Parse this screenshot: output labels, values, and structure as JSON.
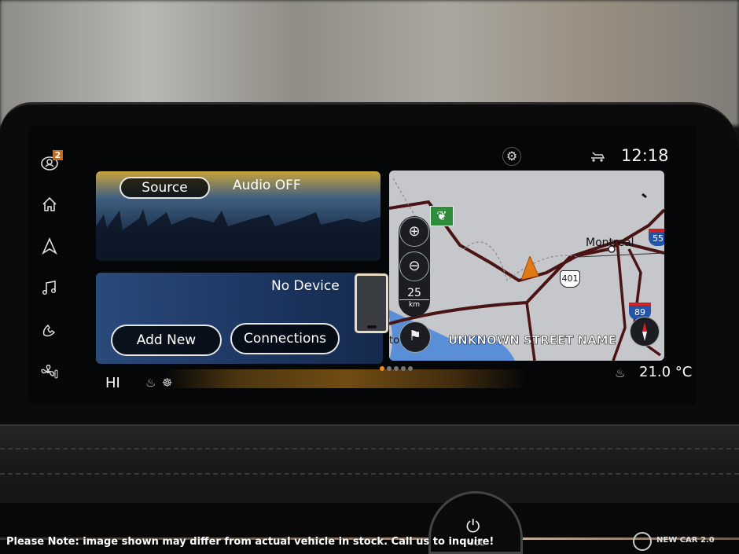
{
  "status_bar": {
    "time": "12:18",
    "notification_count": "2",
    "icons": [
      "profile-icon",
      "settings-gear-icon",
      "car-icon"
    ]
  },
  "sidebar": {
    "items": [
      {
        "name": "profile",
        "icon": "profile-icon"
      },
      {
        "name": "home",
        "icon": "home-icon"
      },
      {
        "name": "navigation",
        "icon": "navigation-arrow-icon"
      },
      {
        "name": "music",
        "icon": "music-note-icon"
      },
      {
        "name": "phone",
        "icon": "phone-icon"
      },
      {
        "name": "climate",
        "icon": "fan-icon"
      }
    ]
  },
  "audio_card": {
    "source_label": "Source",
    "status": "Audio OFF"
  },
  "phone_card": {
    "status": "No Device",
    "add_new_label": "Add New",
    "connections_label": "Connections"
  },
  "map": {
    "city_label": "Montreal",
    "highway_401": "401",
    "interstate_55": "55",
    "interstate_89": "89",
    "scale_value": "25",
    "scale_unit": "km",
    "street_name": "UNKNOWN STREET NAME",
    "partial_label": "to"
  },
  "page_indicator": {
    "count": 5,
    "active": 1,
    "active_color": "#f08a1c"
  },
  "climate": {
    "fan_level": "HI",
    "temperature": "21.0 °C"
  },
  "footer": {
    "note": "Please Note: image shown may differ from actual vehicle in stock. Call us to inquire!",
    "vol_label": "VOL",
    "brand": "NEW CAR 2.0"
  }
}
